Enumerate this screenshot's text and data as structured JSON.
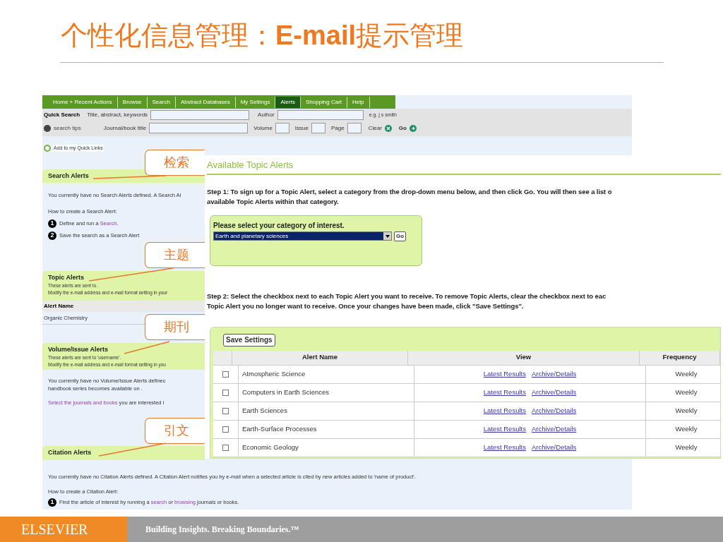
{
  "slide_title": "个性化信息管理：**E-mail**提示管理",
  "nav_tabs": [
    {
      "label": "Home + Recent Actions",
      "selected": false
    },
    {
      "label": "Browse",
      "selected": false
    },
    {
      "label": "Search",
      "selected": false
    },
    {
      "label": "Abstract Databases",
      "selected": false
    },
    {
      "label": "My Settings",
      "selected": false
    },
    {
      "label": "Alerts",
      "selected": true
    },
    {
      "label": "Shopping Cart",
      "selected": false
    },
    {
      "label": "Help",
      "selected": false
    }
  ],
  "quick_search": {
    "heading": "Quick Search",
    "keywords_label": "Title, abstract, keywords",
    "author_label": "Author",
    "author_hint": "e.g. j s smith",
    "tips": "search tips",
    "journal_label": "Journal/book title",
    "volume_label": "Volume",
    "issue_label": "Issue",
    "page_label": "Page",
    "clear": "Clear",
    "go": "Go"
  },
  "quick_links": "Add to my Quick Links",
  "search_alerts": {
    "title": "Search Alerts",
    "text": "You currently have no Search Alerts defined. A Search Al",
    "how_to": "How to create a Search Alert:",
    "steps": [
      {
        "number": "1",
        "parts": [
          {
            "text": "Define and run a "
          },
          {
            "link": "Search"
          },
          {
            "text": "."
          }
        ]
      },
      {
        "number": "2",
        "parts": [
          {
            "text": "Save the search as a Search Alert"
          }
        ]
      }
    ]
  },
  "topic_alerts": {
    "title": "Topic Alerts",
    "sent_to": "These alerts are sent to .",
    "modify": "Modify the e-mail address and e-mail format setting in your",
    "column": "Alert Name",
    "rows": [
      "Organic Chemistry"
    ]
  },
  "volume_alerts": {
    "title": "Volume/Issue Alerts",
    "sent_to": "These alerts are sent to 'username'.",
    "modify": "Modify the e-mail address and e-mail format setting in you",
    "text": "You currently have no Volume/Issue Alerts definec\nhandbook series becomes available on .",
    "select_parts": [
      {
        "link": "Select the journals and books"
      },
      {
        "text": " you are interested i"
      }
    ]
  },
  "citation_alerts": {
    "title": "Citation Alerts",
    "text": "You currently have no Citation Alerts defined. A Citation Alert notifies you by e-mail when a selected article is cited by new articles added to 'name of product'.",
    "how_to": "How to create a Citation Alert:",
    "steps": [
      {
        "number": "1",
        "parts": [
          {
            "text": "Find the article of interest by running a "
          },
          {
            "link": "search"
          },
          {
            "text": " or "
          },
          {
            "link": "browsing"
          },
          {
            "text": " journals or books."
          }
        ]
      }
    ]
  },
  "topic_panel": {
    "title": "Available Topic Alerts",
    "step1": "Step 1: To sign up for a Topic Alert, select a category from the drop-down menu below, and then click Go. You will then see a list o\navailable Topic Alerts within that category.",
    "select_label": "Please select your category of interest.",
    "category": "Earth and planetary sciences",
    "go": "Go",
    "step2": "Step 2: Select the checkbox next to each Topic Alert you want to receive. To remove Topic Alerts, clear the checkbox next to eac\nTopic Alert you no longer want to receive. Once your changes have been made, click \"Save Settings\".",
    "save": "Save Settings",
    "columns": [
      "Alert Name",
      "View",
      "Frequency"
    ],
    "rows": [
      {
        "checked": false,
        "name": "Atmospheric Science",
        "links": [
          "Latest Results",
          "Archive/Details"
        ],
        "frequency": "Weekly"
      },
      {
        "checked": false,
        "name": "Computers in Earth Sciences",
        "links": [
          "Latest Results",
          "Archive/Details"
        ],
        "frequency": "Weekly"
      },
      {
        "checked": false,
        "name": "Earth Sciences",
        "links": [
          "Latest Results",
          "Archive/Details"
        ],
        "frequency": "Weekly"
      },
      {
        "checked": false,
        "name": "Earth-Surface Processes",
        "links": [
          "Latest Results",
          "Archive/Details"
        ],
        "frequency": "Weekly"
      },
      {
        "checked": false,
        "name": "Economic Geology",
        "links": [
          "Latest Results",
          "Archive/Details"
        ],
        "frequency": "Weekly"
      }
    ]
  },
  "callouts": [
    "检索",
    "主题",
    "期刊",
    "引文"
  ],
  "footer": {
    "brand": "ELSEVIER",
    "tagline": "Building Insights. Breaking Boundaries.™"
  }
}
